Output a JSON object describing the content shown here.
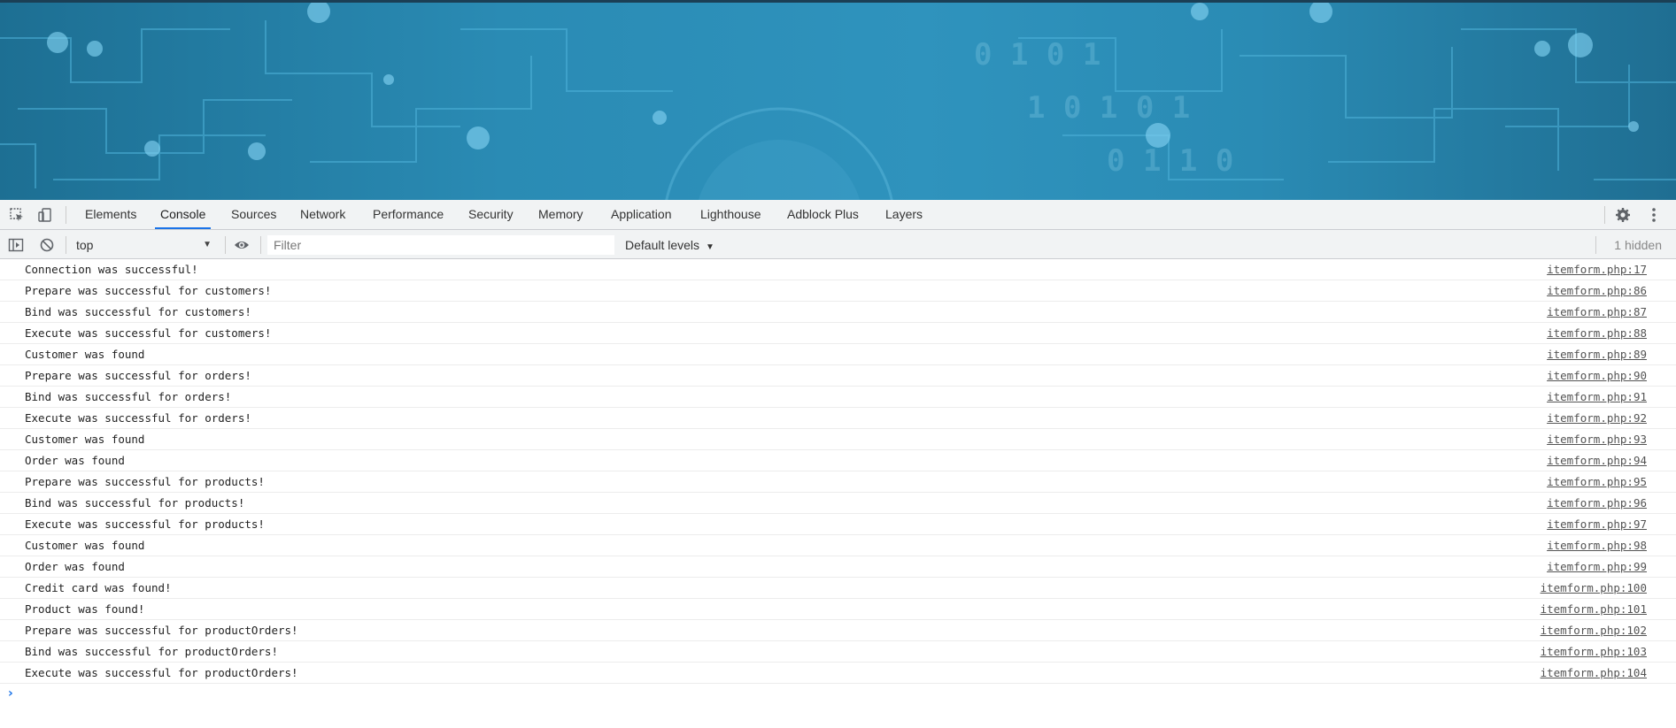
{
  "devtools": {
    "tabs": [
      {
        "label": "Elements"
      },
      {
        "label": "Console",
        "active": true
      },
      {
        "label": "Sources"
      },
      {
        "label": "Network"
      },
      {
        "label": "Performance"
      },
      {
        "label": "Security"
      },
      {
        "label": "Memory"
      },
      {
        "label": "Application"
      },
      {
        "label": "Lighthouse"
      },
      {
        "label": "Adblock Plus"
      },
      {
        "label": "Layers"
      }
    ],
    "accent_color": "#1a73e8"
  },
  "console_toolbar": {
    "context": "top",
    "filter_placeholder": "Filter",
    "levels": "Default levels",
    "hidden": "1 hidden"
  },
  "messages": [
    {
      "text": "Connection was successful!",
      "source": "itemform.php:17"
    },
    {
      "text": "Prepare was successful for customers!",
      "source": "itemform.php:86"
    },
    {
      "text": "Bind was successful for customers!",
      "source": "itemform.php:87"
    },
    {
      "text": "Execute was successful for customers!",
      "source": "itemform.php:88"
    },
    {
      "text": "Customer was found",
      "source": "itemform.php:89"
    },
    {
      "text": "Prepare was successful for orders!",
      "source": "itemform.php:90"
    },
    {
      "text": "Bind was successful for orders!",
      "source": "itemform.php:91"
    },
    {
      "text": "Execute was successful for orders!",
      "source": "itemform.php:92"
    },
    {
      "text": "Customer was found",
      "source": "itemform.php:93"
    },
    {
      "text": "Order was found",
      "source": "itemform.php:94"
    },
    {
      "text": "Prepare was successful for products!",
      "source": "itemform.php:95"
    },
    {
      "text": "Bind was successful for products!",
      "source": "itemform.php:96"
    },
    {
      "text": "Execute was successful for products!",
      "source": "itemform.php:97"
    },
    {
      "text": "Customer was found",
      "source": "itemform.php:98"
    },
    {
      "text": "Order was found",
      "source": "itemform.php:99"
    },
    {
      "text": "Credit card was found!",
      "source": "itemform.php:100"
    },
    {
      "text": "Product was found!",
      "source": "itemform.php:101"
    },
    {
      "text": "Prepare was successful for productOrders!",
      "source": "itemform.php:102"
    },
    {
      "text": "Bind was successful for productOrders!",
      "source": "itemform.php:103"
    },
    {
      "text": "Execute was successful for productOrders!",
      "source": "itemform.php:104"
    }
  ]
}
